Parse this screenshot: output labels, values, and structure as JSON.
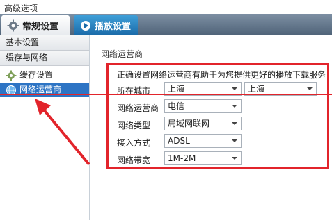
{
  "window": {
    "title": "高级选项"
  },
  "tabs": [
    {
      "label": "常规设置",
      "icon": "gear-icon"
    },
    {
      "label": "播放设置",
      "icon": "play-settings-icon"
    }
  ],
  "sidebar": {
    "sections": [
      {
        "label": "基本设置"
      },
      {
        "label": "缓存与网络"
      }
    ],
    "items": [
      {
        "label": "缓存设置",
        "icon": "cache-icon"
      },
      {
        "label": "网络运营商",
        "icon": "network-globe-icon",
        "selected": true
      }
    ]
  },
  "main": {
    "group_title": "网络运营商",
    "hint": "正确设置网络运营商有助于为您提供更好的播放下载服务",
    "fields": {
      "city": {
        "label": "所在城市",
        "province": "上海",
        "city": "上海"
      },
      "isp": {
        "label": "网络运营商",
        "value": "电信"
      },
      "net_type": {
        "label": "网络类型",
        "value": "局域网联网"
      },
      "access": {
        "label": "接入方式",
        "value": "ADSL"
      },
      "bandwidth": {
        "label": "网络带宽",
        "value": "1M-2M"
      }
    }
  },
  "colors": {
    "highlight": "#e2242b",
    "selected": "#2d74c4",
    "tab_active_bg": "#ffffff",
    "tabbar_bg": "#5a6e84"
  }
}
